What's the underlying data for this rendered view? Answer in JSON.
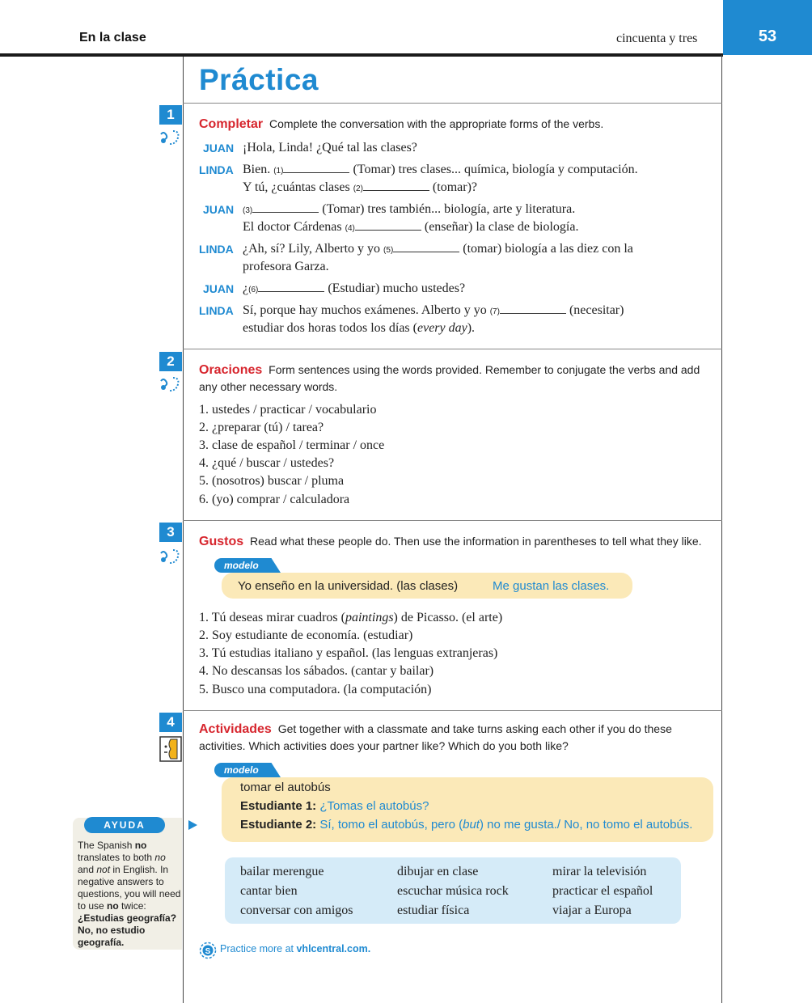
{
  "header": {
    "left": "En la clase",
    "right": "cincuenta y tres",
    "page_number": "53"
  },
  "title": "Práctica",
  "act1": {
    "number": "1",
    "keyword": "Completar",
    "instruction": "Complete the conversation with the appropriate forms of the verbs.",
    "lines": [
      {
        "speaker": "JUAN",
        "l1a": "¡Hola, Linda! ¿Qué tal las clases?"
      },
      {
        "speaker": "LINDA",
        "l1a": "Bien.",
        "n1": "(1)",
        "l1b": "(Tomar) tres clases... química, biología y computación.",
        "l2a": "Y tú, ¿cuántas clases",
        "n2": "(2)",
        "l2b": "(tomar)?"
      },
      {
        "speaker": "JUAN",
        "n1": "(3)",
        "l1b": "(Tomar) tres también... biología, arte y literatura.",
        "l2a": "El doctor Cárdenas",
        "n2": "(4)",
        "l2b": "(enseñar) la clase de biología."
      },
      {
        "speaker": "LINDA",
        "l1a": "¿Ah, sí? Lily, Alberto y yo",
        "n1": "(5)",
        "l1b": "(tomar) biología a las diez con la",
        "l2a": "profesora Garza."
      },
      {
        "speaker": "JUAN",
        "l1a": "¿",
        "n1": "(6)",
        "l1b": "(Estudiar) mucho ustedes?"
      },
      {
        "speaker": "LINDA",
        "l1a": "Sí, porque hay muchos exámenes. Alberto y yo",
        "n1": "(7)",
        "l1b": "(necesitar)",
        "l2a": "estudiar dos horas todos los días (",
        "l2i": "every day",
        "l2b": ")."
      }
    ]
  },
  "act2": {
    "number": "2",
    "keyword": "Oraciones",
    "instruction": "Form sentences using the words provided. Remember to conjugate the verbs and add any other necessary words.",
    "items": [
      "1. ustedes / practicar / vocabulario",
      "2. ¿preparar (tú) / tarea?",
      "3. clase de español / terminar / once",
      "4. ¿qué / buscar / ustedes?",
      "5. (nosotros) buscar / pluma",
      "6. (yo) comprar / calculadora"
    ]
  },
  "act3": {
    "number": "3",
    "keyword": "Gustos",
    "instruction": "Read what these people do. Then use the information in parentheses to tell what they like.",
    "modelo_label": "modelo",
    "modelo_prompt": "Yo enseño en la universidad. (las clases)",
    "modelo_answer": "Me gustan las clases.",
    "items": [
      {
        "a": "1. Tú deseas mirar cuadros (",
        "i": "paintings",
        "b": ") de Picasso. (el arte)"
      },
      {
        "a": "2. Soy estudiante de economía. (estudiar)"
      },
      {
        "a": "3. Tú estudias italiano y español. (las lenguas extranjeras)"
      },
      {
        "a": "4. No descansas los sábados. (cantar y bailar)"
      },
      {
        "a": "5. Busco una computadora. (la computación)"
      }
    ]
  },
  "act4": {
    "number": "4",
    "keyword": "Actividades",
    "instruction": "Get together with a classmate and take turns asking each other if you do these activities. Which activities does your partner like? Which do you both like?",
    "modelo_label": "modelo",
    "modelo_prompt": "tomar el autobús",
    "s1_label": "Estudiante 1:",
    "s1_text": "¿Tomas el autobús?",
    "s2_label": "Estudiante 2:",
    "s2_text_a": "Sí, tomo el autobús, pero (",
    "s2_text_i": "but",
    "s2_text_b": ") no me gusta./ No, no tomo el autobús.",
    "word_bank": [
      [
        "bailar merengue",
        "cantar bien",
        "conversar con amigos"
      ],
      [
        "dibujar en clase",
        "escuchar música rock",
        "estudiar física"
      ],
      [
        "mirar la televisión",
        "practicar el español",
        "viajar a Europa"
      ]
    ]
  },
  "ayuda": {
    "label": "AYUDA",
    "t1": "The Spanish ",
    "t1b": "no",
    "t2": " translates to both ",
    "t2i": "no",
    "t3": " and ",
    "t3i": "not",
    "t4": " in English. In negative answers to questions, you will need to use ",
    "t4b": "no",
    "t5": " twice:",
    "ex1": "¿Estudias geografía?",
    "ex2": "No, no estudio geografía."
  },
  "practice": {
    "text": "Practice more at ",
    "site": "vhlcentral.com."
  },
  "colors": {
    "accent_blue": "#1f8ad1",
    "keyword_red": "#d7262e",
    "modelo_yellow": "#fbe9b8",
    "wordbank_blue": "#d5ebf8"
  }
}
